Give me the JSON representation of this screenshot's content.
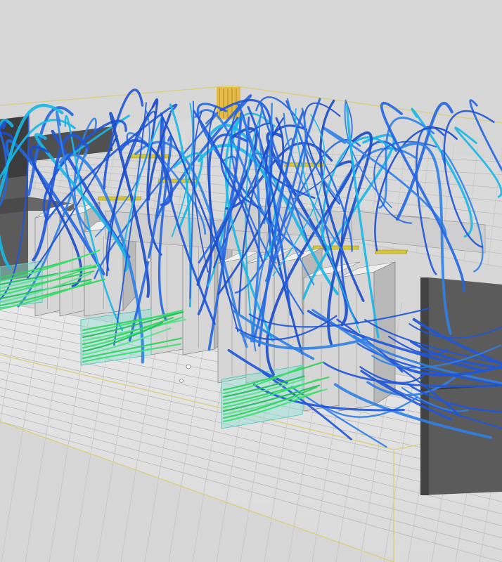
{
  "scene": {
    "title": "",
    "colors": {
      "background": "#d7d7d7",
      "floor_tile": "#e3e3e3",
      "floor_grid": "#b3b3b3",
      "boundary_outline": "#d8cf7a",
      "rack_front": "#d6d6d6",
      "rack_side": "#b9b9b9",
      "rack_top": "#efefef",
      "crah_unit": "#5b5b5b",
      "crah_unit_dark": "#4a4a4a",
      "ceiling_grid": "#c8c8c8",
      "light_fixture": "#d6c63a",
      "return_vent": "#e7b93a",
      "supply_tile": "#8fe0d6",
      "airflow_cool": "#2fd15a",
      "airflow_mid": "#18b7e6",
      "airflow_warm": "#1f55d8"
    },
    "icons": [
      "airflow-streamline",
      "server-rack",
      "crah-unit",
      "perforated-floor-tile",
      "ceiling-return-vent"
    ]
  }
}
